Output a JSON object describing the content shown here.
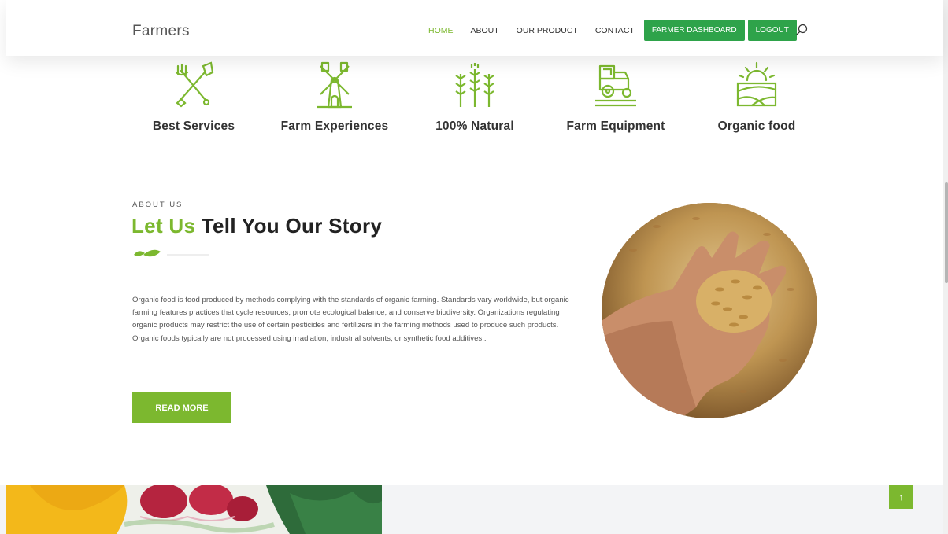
{
  "header": {
    "brand": "Farmers",
    "nav": {
      "home": "HOME",
      "about": "ABOUT",
      "product": "OUR PRODUCT",
      "contact": "CONTACT",
      "dashboard": "FARMER DASHBOARD",
      "logout": "LOGOUT"
    },
    "search_icon": "search-icon"
  },
  "features": [
    {
      "label": "Best Services",
      "icon": "tools-icon"
    },
    {
      "label": "Farm Experiences",
      "icon": "windmill-icon"
    },
    {
      "label": "100% Natural",
      "icon": "wheat-icon"
    },
    {
      "label": "Farm Equipment",
      "icon": "tractor-icon"
    },
    {
      "label": "Organic food",
      "icon": "sunrise-field-icon"
    }
  ],
  "about": {
    "eyebrow": "ABOUT US",
    "heading_accent": "Let Us",
    "heading_rest": "Tell You Our Story",
    "body": "Organic food is food produced by methods complying with the standards of organic farming. Standards vary worldwide, but organic farming features practices that cycle resources, promote ecological balance, and conserve biodiversity. Organizations regulating organic products may restrict the use of certain pesticides and fertilizers in the farming methods used to produce such products. Organic foods typically are not processed using irradiation, industrial solvents, or synthetic food additives..",
    "button": "READ MORE"
  },
  "scroll_top": "↑",
  "colors": {
    "accent": "#7cb82f",
    "button_green": "#2ea34a",
    "text": "#222222"
  }
}
